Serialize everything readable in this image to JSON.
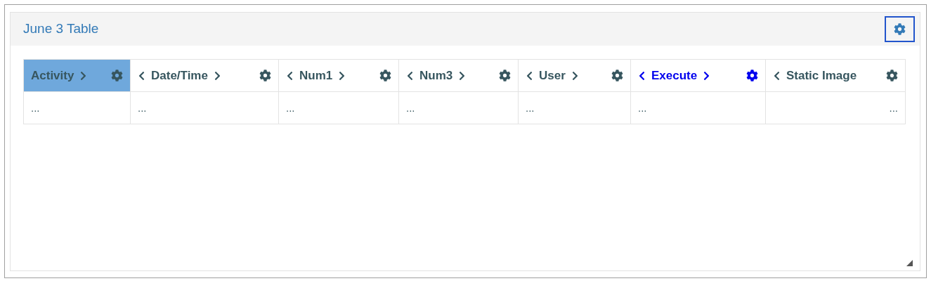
{
  "panel": {
    "title": "June 3 Table"
  },
  "table": {
    "columns": [
      {
        "label": "Activity",
        "kind": "text",
        "selected": true,
        "hovered": false,
        "has_left": false,
        "has_right": true
      },
      {
        "label": "Date/Time",
        "kind": "text",
        "selected": false,
        "hovered": false,
        "has_left": true,
        "has_right": true
      },
      {
        "label": "Num1",
        "kind": "text",
        "selected": false,
        "hovered": false,
        "has_left": true,
        "has_right": true
      },
      {
        "label": "Num3",
        "kind": "text",
        "selected": false,
        "hovered": false,
        "has_left": true,
        "has_right": true
      },
      {
        "label": "User",
        "kind": "text",
        "selected": false,
        "hovered": false,
        "has_left": true,
        "has_right": true
      },
      {
        "label": "Execute",
        "kind": "text",
        "selected": false,
        "hovered": true,
        "has_left": true,
        "has_right": true
      },
      {
        "label": "Static Image",
        "kind": "image",
        "selected": false,
        "hovered": false,
        "has_left": true,
        "has_right": false
      }
    ],
    "rows": [
      [
        "...",
        "...",
        "...",
        "...",
        "...",
        "...",
        "..."
      ]
    ]
  }
}
